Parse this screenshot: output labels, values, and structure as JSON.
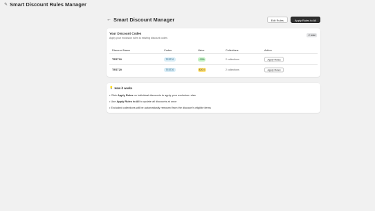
{
  "appbar": {
    "title": "Smart Discount Rules Manager",
    "icon": "app-icon"
  },
  "header": {
    "title": "Smart Discount Manager",
    "edit_rules_label": "Edit Rules",
    "apply_all_label": "Apply Rules to All"
  },
  "codes_card": {
    "title": "Your Discount Codes",
    "subtitle": "Apply your exclusion rules to existing discount codes",
    "count_badge": "2 total",
    "columns": [
      "Discount Name",
      "Codes",
      "Value",
      "Collections",
      "Action"
    ],
    "rows": [
      {
        "name": "TEST10",
        "code": "TEST10",
        "value": "-10%",
        "value_color": "#c5f2c4",
        "collections": "2 collections",
        "action": "Apply Rules"
      },
      {
        "name": "TEST20",
        "code": "TEST20",
        "value": "$20.0",
        "value_color": "#ffe27a",
        "collections": "2 collections",
        "action": "Apply Rules"
      }
    ]
  },
  "how_card": {
    "title": "How it works",
    "items": [
      {
        "prefix": "• Click ",
        "bold": "Apply Rules",
        "suffix": " on individual discounts to apply your exclusion rules"
      },
      {
        "prefix": "• Use ",
        "bold": "Apply Rules to All",
        "suffix": " to update all discounts at once"
      },
      {
        "prefix": "• Excluded collections will be automatically removed from the discount's eligible items",
        "bold": "",
        "suffix": ""
      }
    ]
  },
  "colors": {
    "primary_button": "#303030",
    "code_badge": "#d9edf7",
    "background": "#f1f1f1"
  }
}
